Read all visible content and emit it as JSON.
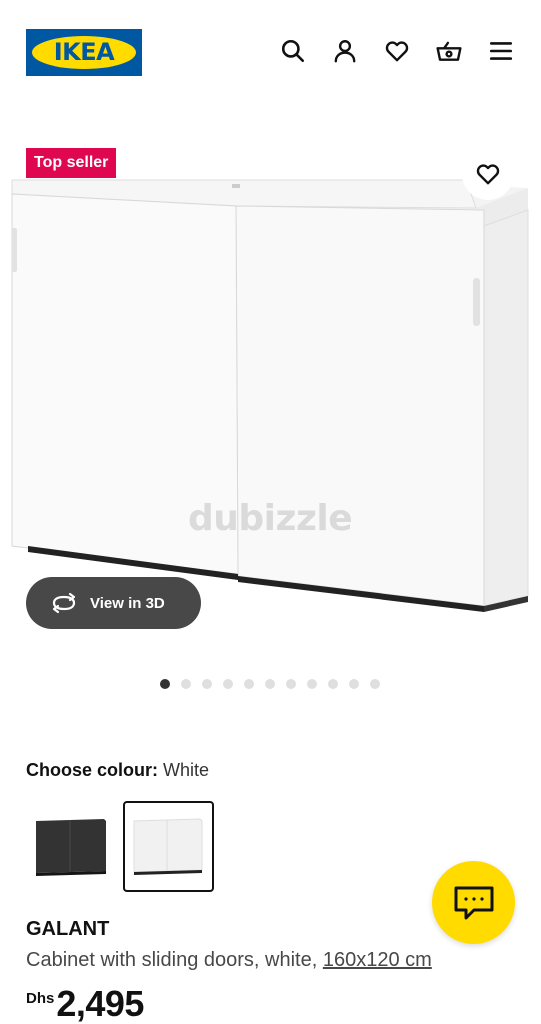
{
  "header": {
    "logo_text": "IKEA",
    "icons": [
      "search-icon",
      "account-icon",
      "heart-icon",
      "basket-icon",
      "menu-icon"
    ]
  },
  "hero": {
    "badge": "Top seller",
    "watermark": "dubizzle",
    "view3d_label": "View in 3D",
    "image_count": 11,
    "active_image_index": 0
  },
  "colour": {
    "label": "Choose colour:",
    "value": "White",
    "options": [
      "black",
      "white"
    ],
    "selected_option": "white"
  },
  "product": {
    "name": "GALANT",
    "description": "Cabinet with sliding doors, white,",
    "dimensions": "160x120 cm",
    "currency": "Dhs",
    "price": "2,495"
  },
  "colors": {
    "ikea_blue": "#0058a3",
    "ikea_yellow": "#ffdb00",
    "badge_red": "#e00751",
    "view3d_bg": "#484848"
  }
}
